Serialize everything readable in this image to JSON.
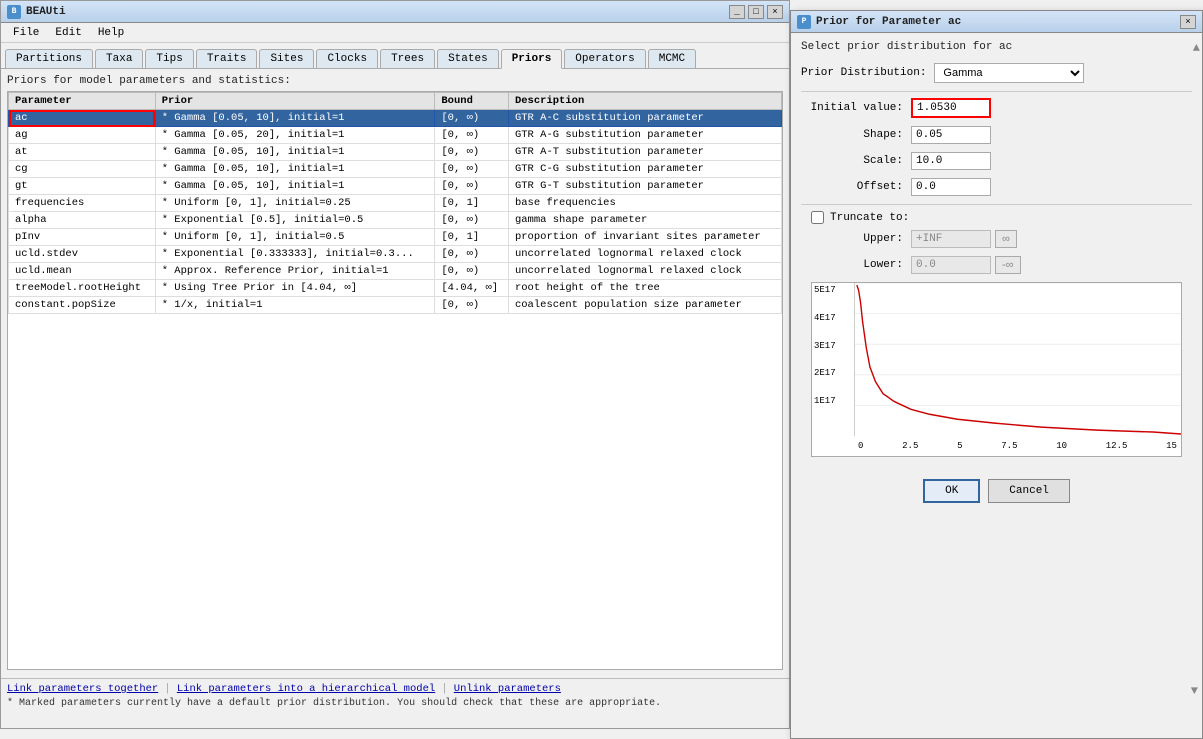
{
  "mainWindow": {
    "title": "BEAUti",
    "icon": "B"
  },
  "menu": {
    "items": [
      "File",
      "Edit",
      "Help"
    ]
  },
  "tabs": [
    {
      "label": "Partitions",
      "active": false
    },
    {
      "label": "Taxa",
      "active": false
    },
    {
      "label": "Tips",
      "active": false
    },
    {
      "label": "Traits",
      "active": false
    },
    {
      "label": "Sites",
      "active": false
    },
    {
      "label": "Clocks",
      "active": false
    },
    {
      "label": "Trees",
      "active": false
    },
    {
      "label": "States",
      "active": false
    },
    {
      "label": "Priors",
      "active": true
    },
    {
      "label": "Operators",
      "active": false
    },
    {
      "label": "MCMC",
      "active": false
    }
  ],
  "sectionTitle": "Priors for model parameters and statistics:",
  "tableHeaders": [
    "Parameter",
    "Prior",
    "Bound",
    "Description"
  ],
  "tableRows": [
    {
      "param": "ac",
      "prior": "* Gamma [0.05, 10], initial=1",
      "bound": "[0, ∞)",
      "description": "GTR A-C substitution parameter",
      "selected": true
    },
    {
      "param": "ag",
      "prior": "* Gamma [0.05, 20], initial=1",
      "bound": "[0, ∞)",
      "description": "GTR A-G substitution parameter",
      "selected": false
    },
    {
      "param": "at",
      "prior": "* Gamma [0.05, 10], initial=1",
      "bound": "[0, ∞)",
      "description": "GTR A-T substitution parameter",
      "selected": false
    },
    {
      "param": "cg",
      "prior": "* Gamma [0.05, 10], initial=1",
      "bound": "[0, ∞)",
      "description": "GTR C-G substitution parameter",
      "selected": false
    },
    {
      "param": "gt",
      "prior": "* Gamma [0.05, 10], initial=1",
      "bound": "[0, ∞)",
      "description": "GTR G-T substitution parameter",
      "selected": false
    },
    {
      "param": "frequencies",
      "prior": "* Uniform [0, 1], initial=0.25",
      "bound": "[0, 1]",
      "description": "base frequencies",
      "selected": false
    },
    {
      "param": "alpha",
      "prior": "* Exponential [0.5], initial=0.5",
      "bound": "[0, ∞)",
      "description": "gamma shape parameter",
      "selected": false
    },
    {
      "param": "pInv",
      "prior": "* Uniform [0, 1], initial=0.5",
      "bound": "[0, 1]",
      "description": "proportion of invariant sites parameter",
      "selected": false
    },
    {
      "param": "ucld.stdev",
      "prior": "* Exponential [0.333333], initial=0.3...",
      "bound": "[0, ∞)",
      "description": "uncorrelated lognormal relaxed clock",
      "selected": false
    },
    {
      "param": "ucld.mean",
      "prior": "* Approx. Reference Prior, initial=1",
      "bound": "[0, ∞)",
      "description": "uncorrelated lognormal relaxed clock",
      "selected": false
    },
    {
      "param": "treeModel.rootHeight",
      "prior": "* Using Tree Prior in [4.04, ∞]",
      "bound": "[4.04, ∞]",
      "description": "root height of the tree",
      "selected": false
    },
    {
      "param": "constant.popSize",
      "prior": "* 1/x, initial=1",
      "bound": "[0, ∞)",
      "description": "coalescent population size parameter",
      "selected": false
    }
  ],
  "bottomLinks": [
    "Link parameters together",
    "Link parameters into a hierarchical model",
    "Unlink parameters"
  ],
  "noteText": "* Marked parameters currently have a default prior distribution. You should check that these are appropriate.",
  "dialog": {
    "title": "Prior for Parameter ac",
    "icon": "P",
    "closeBtn": "×",
    "selectLabel": "Select prior distribution for ac",
    "priorDistLabel": "Prior Distribution:",
    "priorDistValue": "Gamma",
    "initialValueLabel": "Initial value:",
    "initialValue": "1.0530",
    "shapeLabel": "Shape:",
    "shapeValue": "0.05",
    "scaleLabel": "Scale:",
    "scaleValue": "10.0",
    "offsetLabel": "Offset:",
    "offsetValue": "0.0",
    "truncateLabel": "Truncate to:",
    "upperLabel": "Upper:",
    "upperValue": "+INF",
    "upperInfBtn": "∞",
    "lowerLabel": "Lower:",
    "lowerValue": "0.0",
    "lowerInfBtn": "-∞",
    "okLabel": "OK",
    "cancelLabel": "Cancel",
    "chartYLabels": [
      "5E17",
      "4E17",
      "3E17",
      "2E17",
      "1E17"
    ],
    "chartXLabels": [
      "0",
      "2.5",
      "5",
      "7.5",
      "10",
      "12.5",
      "15"
    ]
  }
}
